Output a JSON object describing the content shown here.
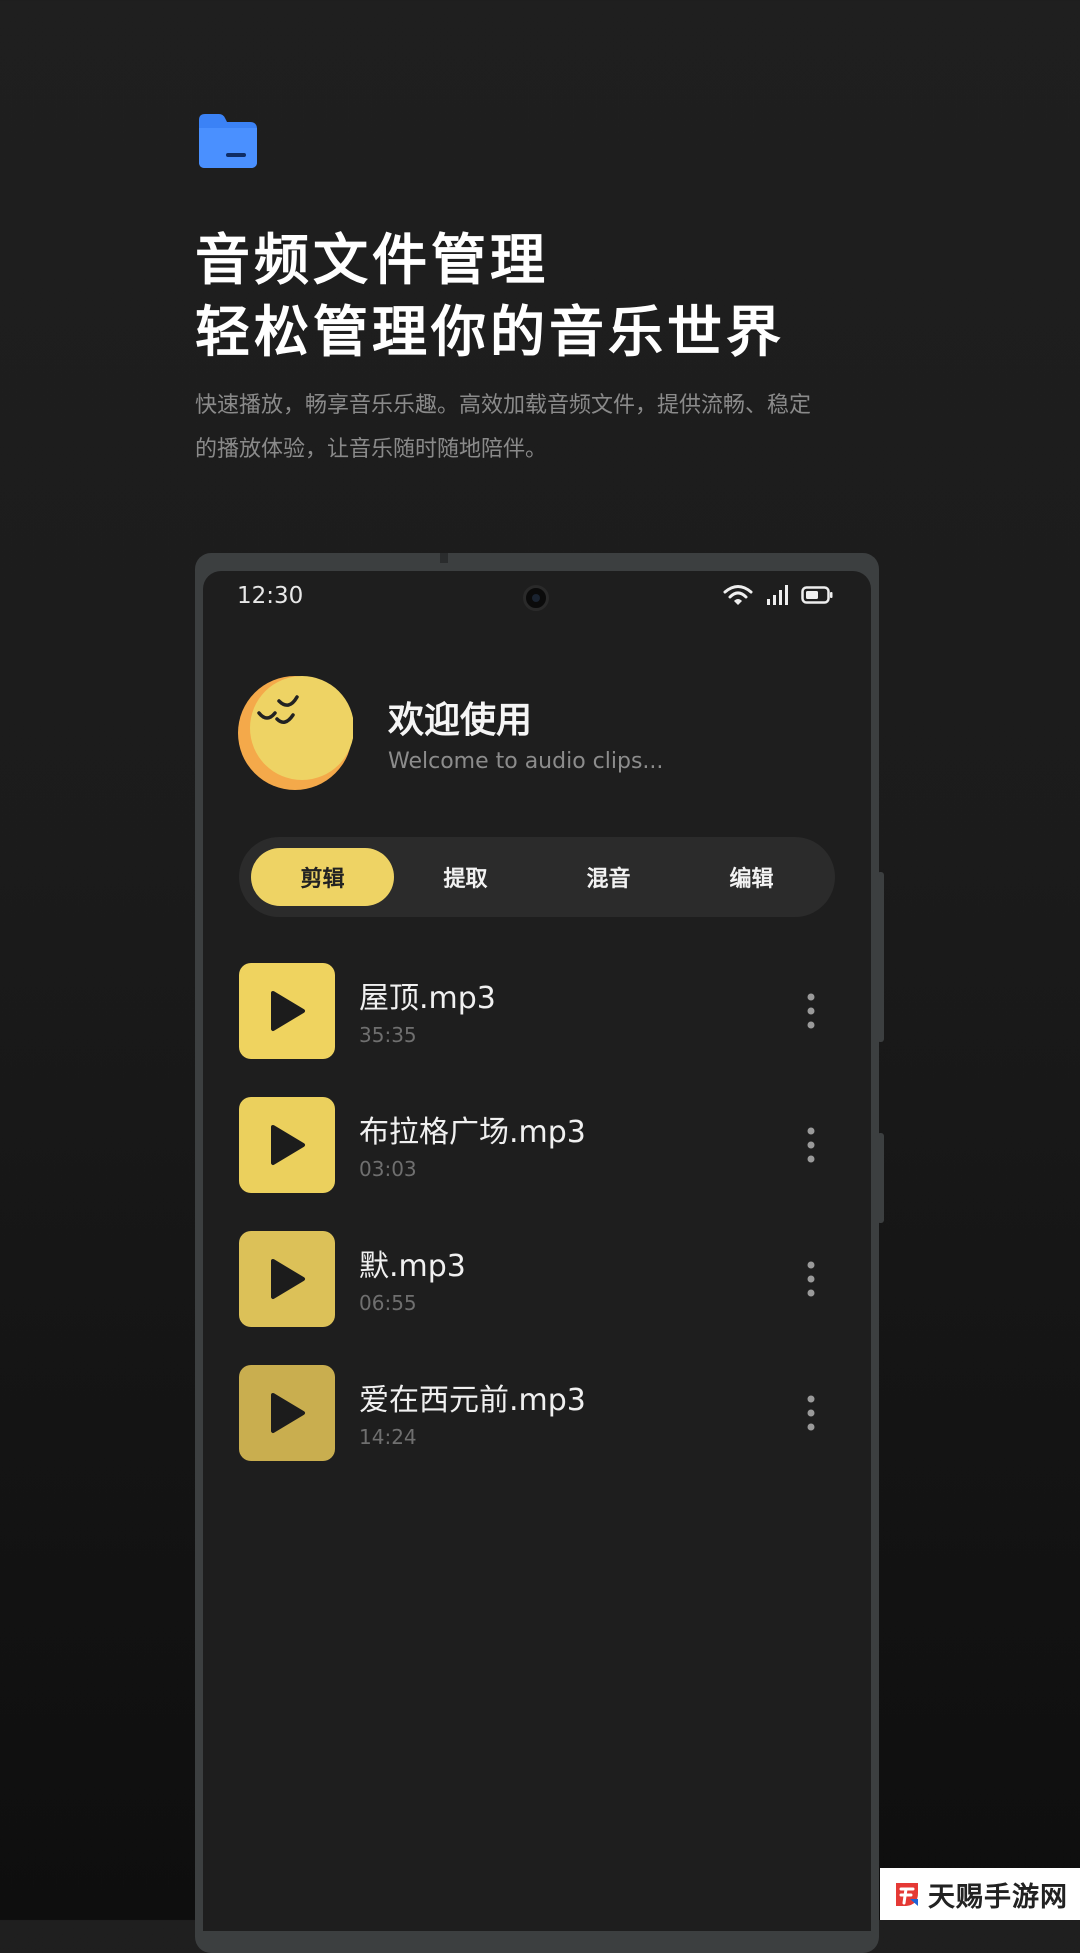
{
  "promo": {
    "headline_line1": "音频文件管理",
    "headline_line2": "轻松管理你的音乐世界",
    "description_line1": "快速播放，畅享音乐乐趣。高效加载音频文件，提供流畅、稳定",
    "description_line2": "的播放体验，让音乐随时随地陪伴。",
    "icon": "folder-icon",
    "icon_color": "#3b82f6"
  },
  "status_bar": {
    "time": "12:30",
    "icons": [
      "wifi-icon",
      "signal-icon",
      "battery-icon"
    ]
  },
  "welcome": {
    "title": "欢迎使用",
    "subtitle": "Welcome to audio clips...",
    "avatar_icon": "sleepy-moon-face-icon"
  },
  "tabs": [
    {
      "label": "剪辑",
      "active": true
    },
    {
      "label": "提取",
      "active": false
    },
    {
      "label": "混音",
      "active": false
    },
    {
      "label": "编辑",
      "active": false
    }
  ],
  "tracks": [
    {
      "title": "屋顶.mp3",
      "duration": "35:35",
      "cover_color": "#efd35f"
    },
    {
      "title": "布拉格广场.mp3",
      "duration": "03:03",
      "cover_color": "#ebd05d"
    },
    {
      "title": "默.mp3",
      "duration": "06:55",
      "cover_color": "#dcc158"
    },
    {
      "title": "爱在西元前.mp3",
      "duration": "14:24",
      "cover_color": "#c9ae4f"
    }
  ],
  "colors": {
    "accent": "#eed364",
    "background": "#1e1e1e"
  },
  "watermark": {
    "text": "天赐手游网"
  }
}
